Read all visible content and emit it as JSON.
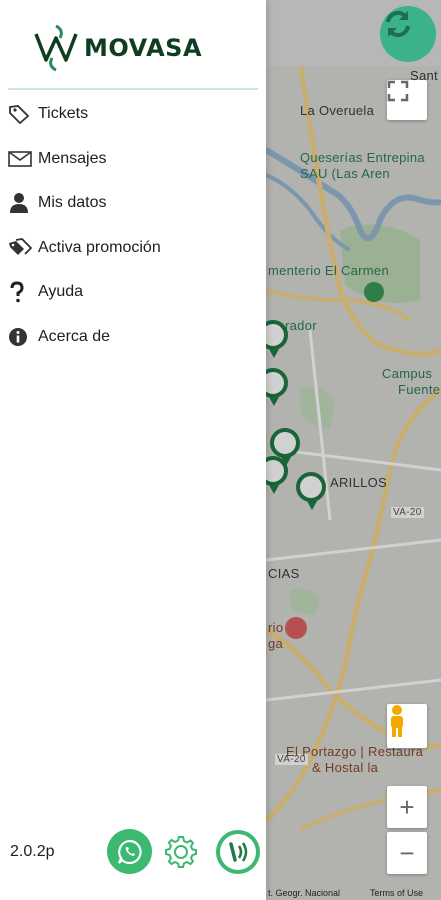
{
  "brand": {
    "name": "MOVASA",
    "color": "#0f3d21",
    "accent": "#3cb870"
  },
  "menu": {
    "items": [
      {
        "label": "Tickets",
        "icon": "tag-icon"
      },
      {
        "label": "Mensajes",
        "icon": "envelope-icon"
      },
      {
        "label": "Mis datos",
        "icon": "user-icon"
      },
      {
        "label": "Activa promoción",
        "icon": "tags-icon"
      },
      {
        "label": "Ayuda",
        "icon": "question-icon"
      },
      {
        "label": "Acerca de",
        "icon": "info-icon"
      }
    ]
  },
  "footer": {
    "version": "2.0.2p",
    "buttons": [
      "whatsapp-icon",
      "gear-icon",
      "nfc-icon"
    ]
  },
  "map": {
    "labels": {
      "santo": "Sant",
      "overuela": "La Overuela",
      "queserias": "Queserías Entrepina",
      "queserias2": "SAU (Las Aren",
      "cementerio": "menterio El Carmen",
      "rador": "rador",
      "campus": "Campus",
      "fuente": "Fuente",
      "arillos": "ARILLOS",
      "va20": "VA-20",
      "cias": "CIAS",
      "rio": "rio",
      "ga": "ga",
      "va20b": "VA-20",
      "portazgo": "El Portazgo | Restaura",
      "hostal": "& Hostal la",
      "georg": "t. Geogr. Nacional",
      "terms": "Terms of Use"
    },
    "zoom_in": "+",
    "zoom_out": "−"
  }
}
